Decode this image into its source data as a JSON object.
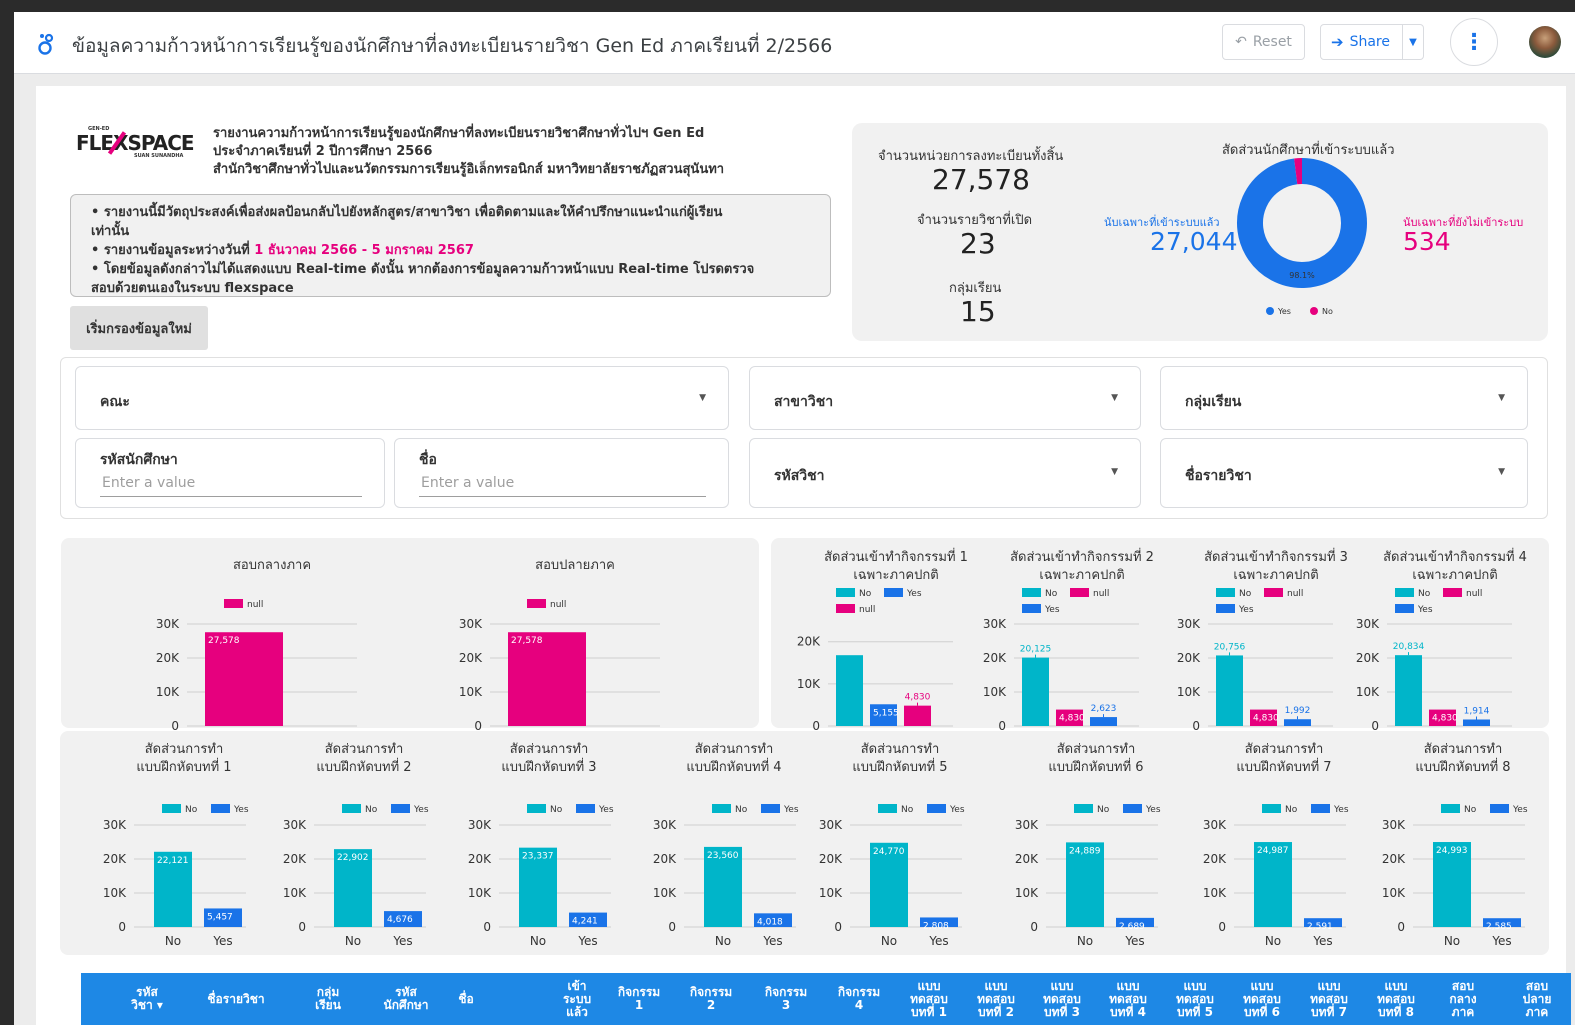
{
  "app": {
    "title": "ข้อมูลความก้าวหน้าการเรียนรู้ของนักศึกษาที่ลงทะเบียนรายวิชา Gen Ed ภาคเรียนที่ 2/2566",
    "reset_label": "Reset",
    "share_label": "Share"
  },
  "logo": {
    "top": "GEN-ED",
    "main": "FLEXSPACE",
    "sub": "SUAN SUNANDHA"
  },
  "header": {
    "line1": "รายงานความก้าวหน้าการเรียนรู้ของนักศึกษาที่ลงทะเบียนรายวิชาศึกษาทั่วไปฯ Gen Ed",
    "line2": "ประจำภาคเรียนที่ 2 ปีการศึกษา 2566",
    "line3": "สำนักวิชาศึกษาทั่วไปและนวัตกรรมการเรียนรู้อิเล็กทรอนิกส์ มหาวิทยาลัยราชภัฏสวนสุนันทา"
  },
  "notice": {
    "b1": "• รายงานนี้มีวัตถุประสงค์เพื่อส่งผลป้อนกลับไปยังหลักสูตร/สาขาวิชา เพื่อติดตามและให้คำปรึกษาแนะนำแก่ผู้เรียน",
    "b1b": "เท่านั้น",
    "b2_prefix": "• รายงานข้อมูลระหว่างวันที่ ",
    "b2_range": "1 ธันวาคม 2566 - 5 มกราคม 2567",
    "b3": "• โดยข้อมูลดังกล่าวไม่ได้แสดงแบบ Real-time ดังนั้น หากต้องการข้อมูลความก้าวหน้าแบบ Real-time โปรดตรวจ",
    "b3b": "สอบด้วยตนเองในระบบ flexspace"
  },
  "reset_filter_label": "เริ่มกรองข้อมูลใหม่",
  "kpi": {
    "enroll_label": "จำนวนหน่วยการลงทะเบียนทั้งสิ้น",
    "enroll_value": "27,578",
    "courses_label": "จำนวนรายวิชาที่เปิด",
    "courses_value": "23",
    "groups_label": "กลุ่มเรียน",
    "groups_value": "15",
    "ratio_title": "สัดส่วนนักศึกษาที่เข้าระบบแล้ว",
    "logged_label": "นับเฉพาะที่เข้าระบบแล้ว",
    "logged_value": "27,044",
    "notlogged_label": "นับเฉพาะที่ยังไม่เข้าระบบ",
    "notlogged_value": "534"
  },
  "filters": {
    "faculty": "คณะ",
    "major": "สาขาวิชา",
    "group": "กลุ่มเรียน",
    "student_id": "รหัสนักศึกษา",
    "name": "ชื่อ",
    "course_code": "รหัสวิชา",
    "course_name": "ชื่อรายวิชา",
    "placeholder": "Enter a value"
  },
  "colors": {
    "teal": "#00b5c9",
    "blue": "#1a73e8",
    "pink": "#e6007e",
    "header_blue": "#1e88e5"
  },
  "chart_data": [
    {
      "type": "pie",
      "title": "สัดส่วนนักศึกษาที่เข้าระบบแล้ว",
      "categories": [
        "Yes",
        "No"
      ],
      "values": [
        27044,
        534
      ],
      "data_label": "98.1%",
      "legend": "bottom",
      "donut": true
    },
    {
      "type": "bar",
      "title": "สอบกลางภาค",
      "categories": [
        ""
      ],
      "series": [
        {
          "name": "null",
          "values": [
            27578
          ]
        }
      ],
      "ylim": [
        0,
        30000
      ],
      "ticks": [
        "0",
        "10K",
        "20K",
        "30K"
      ],
      "data_labels": [
        "27,578"
      ]
    },
    {
      "type": "bar",
      "title": "สอบปลายภาค",
      "categories": [
        ""
      ],
      "series": [
        {
          "name": "null",
          "values": [
            27578
          ]
        }
      ],
      "ylim": [
        0,
        30000
      ],
      "ticks": [
        "0",
        "10K",
        "20K",
        "30K"
      ],
      "data_labels": [
        "27,578"
      ]
    },
    {
      "type": "bar",
      "title": "สัดส่วนเข้าทำกิจกรรมที่ 1 เฉพาะภาคปกติ",
      "categories": [
        "No",
        "Yes",
        "null"
      ],
      "values": [
        16800,
        5155,
        4830
      ],
      "ylim": [
        0,
        22000
      ],
      "ticks": [
        "0",
        "10K",
        "20K"
      ],
      "data_labels": [
        "",
        "5,155",
        "4,830"
      ]
    },
    {
      "type": "bar",
      "title": "สัดส่วนเข้าทำกิจกรรมที่ 2 เฉพาะภาคปกติ",
      "categories": [
        "No",
        "null",
        "Yes"
      ],
      "values": [
        20125,
        4830,
        2623
      ],
      "ylim": [
        0,
        30000
      ],
      "ticks": [
        "0",
        "10K",
        "20K",
        "30K"
      ],
      "data_labels": [
        "20,125",
        "4,830",
        "2,623"
      ]
    },
    {
      "type": "bar",
      "title": "สัดส่วนเข้าทำกิจกรรมที่ 3 เฉพาะภาคปกติ",
      "categories": [
        "No",
        "null",
        "Yes"
      ],
      "values": [
        20756,
        4830,
        1992
      ],
      "ylim": [
        0,
        30000
      ],
      "ticks": [
        "0",
        "10K",
        "20K",
        "30K"
      ],
      "data_labels": [
        "20,756",
        "4,830",
        "1,992"
      ]
    },
    {
      "type": "bar",
      "title": "สัดส่วนเข้าทำกิจกรรมที่ 4 เฉพาะภาคปกติ",
      "categories": [
        "No",
        "null",
        "Yes"
      ],
      "values": [
        20834,
        4830,
        1914
      ],
      "ylim": [
        0,
        30000
      ],
      "ticks": [
        "0",
        "10K",
        "20K",
        "30K"
      ],
      "data_labels": [
        "20,834",
        "4,830",
        "1,914"
      ]
    },
    {
      "type": "bar",
      "title": "สัดส่วนการทำแบบฝึกหัดบทที่ 1",
      "categories": [
        "No",
        "Yes"
      ],
      "values": [
        22121,
        5457
      ],
      "ylim": [
        0,
        30000
      ],
      "ticks": [
        "0",
        "10K",
        "20K",
        "30K"
      ],
      "data_labels": [
        "22,121",
        "5,457"
      ]
    },
    {
      "type": "bar",
      "title": "สัดส่วนการทำแบบฝึกหัดบทที่ 2",
      "categories": [
        "No",
        "Yes"
      ],
      "values": [
        22902,
        4676
      ],
      "ylim": [
        0,
        30000
      ],
      "ticks": [
        "0",
        "10K",
        "20K",
        "30K"
      ],
      "data_labels": [
        "22,902",
        "4,676"
      ]
    },
    {
      "type": "bar",
      "title": "สัดส่วนการทำแบบฝึกหัดบทที่ 3",
      "categories": [
        "No",
        "Yes"
      ],
      "values": [
        23337,
        4241
      ],
      "ylim": [
        0,
        30000
      ],
      "ticks": [
        "0",
        "10K",
        "20K",
        "30K"
      ],
      "data_labels": [
        "23,337",
        "4,241"
      ]
    },
    {
      "type": "bar",
      "title": "สัดส่วนการทำแบบฝึกหัดบทที่ 4",
      "categories": [
        "No",
        "Yes"
      ],
      "values": [
        23560,
        4018
      ],
      "ylim": [
        0,
        30000
      ],
      "ticks": [
        "0",
        "10K",
        "20K",
        "30K"
      ],
      "data_labels": [
        "23,560",
        "4,018"
      ]
    },
    {
      "type": "bar",
      "title": "สัดส่วนการทำแบบฝึกหัดบทที่ 5",
      "categories": [
        "No",
        "Yes"
      ],
      "values": [
        24770,
        2808
      ],
      "ylim": [
        0,
        30000
      ],
      "ticks": [
        "0",
        "10K",
        "20K",
        "30K"
      ],
      "data_labels": [
        "24,770",
        "2,808"
      ]
    },
    {
      "type": "bar",
      "title": "สัดส่วนการทำแบบฝึกหัดบทที่ 6",
      "categories": [
        "No",
        "Yes"
      ],
      "values": [
        24889,
        2689
      ],
      "ylim": [
        0,
        30000
      ],
      "ticks": [
        "0",
        "10K",
        "20K",
        "30K"
      ],
      "data_labels": [
        "24,889",
        "2,689"
      ]
    },
    {
      "type": "bar",
      "title": "สัดส่วนการทำแบบฝึกหัดบทที่ 7",
      "categories": [
        "No",
        "Yes"
      ],
      "values": [
        24987,
        2591
      ],
      "ylim": [
        0,
        30000
      ],
      "ticks": [
        "0",
        "10K",
        "20K",
        "30K"
      ],
      "data_labels": [
        "24,987",
        "2,591"
      ]
    },
    {
      "type": "bar",
      "title": "สัดส่วนการทำแบบฝึกหัดบทที่ 8",
      "categories": [
        "No",
        "Yes"
      ],
      "values": [
        24993,
        2585
      ],
      "ylim": [
        0,
        30000
      ],
      "ticks": [
        "0",
        "10K",
        "20K",
        "30K"
      ],
      "data_labels": [
        "24,993",
        "2,585"
      ]
    }
  ],
  "table": {
    "columns": [
      [
        "รหัส",
        "วิชา"
      ],
      [
        "ชื่อรายวิชา"
      ],
      [
        "กลุ่ม",
        "เรียน"
      ],
      [
        "รหัส",
        "นักศึกษา"
      ],
      [
        "ชื่อ"
      ],
      [
        "เข้า",
        "ระบบ",
        "แล้ว"
      ],
      [
        "กิจกรรม",
        "1"
      ],
      [
        "กิจกรรม",
        "2"
      ],
      [
        "กิจกรรม",
        "3"
      ],
      [
        "กิจกรรม",
        "4"
      ],
      [
        "แบบ",
        "ทดสอบ",
        "บทที่ 1"
      ],
      [
        "แบบ",
        "ทดสอบ",
        "บทที่ 2"
      ],
      [
        "แบบ",
        "ทดสอบ",
        "บทที่ 3"
      ],
      [
        "แบบ",
        "ทดสอบ",
        "บทที่ 4"
      ],
      [
        "แบบ",
        "ทดสอบ",
        "บทที่ 5"
      ],
      [
        "แบบ",
        "ทดสอบ",
        "บทที่ 6"
      ],
      [
        "แบบ",
        "ทดสอบ",
        "บทที่ 7"
      ],
      [
        "แบบ",
        "ทดสอบ",
        "บทที่ 8"
      ],
      [
        "สอบ",
        "กลาง",
        "ภาค"
      ],
      [
        "สอบ",
        "ปลาย",
        "ภาค"
      ]
    ]
  }
}
